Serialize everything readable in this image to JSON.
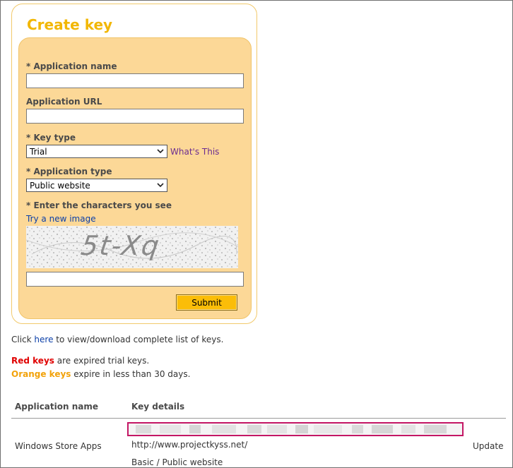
{
  "create_key": {
    "title": "Create key",
    "app_name_label": "* Application name",
    "app_name_value": "",
    "app_url_label": "Application URL",
    "app_url_value": "",
    "key_type_label": "* Key type",
    "key_type_selected": "Trial",
    "whats_this": "What's This",
    "app_type_label": "* Application type",
    "app_type_selected": "Public website",
    "captcha_label": "* Enter the characters you see",
    "try_new_image": "Try a new image",
    "captcha_text": "5t-Xq",
    "captcha_value": "",
    "submit_label": "Submit"
  },
  "info": {
    "click_prefix": "Click ",
    "here_link": "here",
    "click_suffix": " to view/download complete list of keys.",
    "red_keys": "Red keys",
    "red_keys_suffix": " are expired trial keys.",
    "orange_keys": "Orange keys",
    "orange_keys_suffix": " expire in less than 30 days."
  },
  "table": {
    "headers": [
      "Application name",
      "Key details"
    ],
    "rows": [
      {
        "app_name": "Windows Store Apps",
        "url": "http://www.projectkyss.net/",
        "type": "Basic / Public website",
        "action": "Update"
      }
    ]
  },
  "colors": {
    "accent": "#f2b705",
    "panel_bg": "#fcd897",
    "submit_bg": "#fbbd08",
    "expired": "#e00000",
    "expiring": "#f2a20a",
    "key_highlight": "#c41765"
  }
}
